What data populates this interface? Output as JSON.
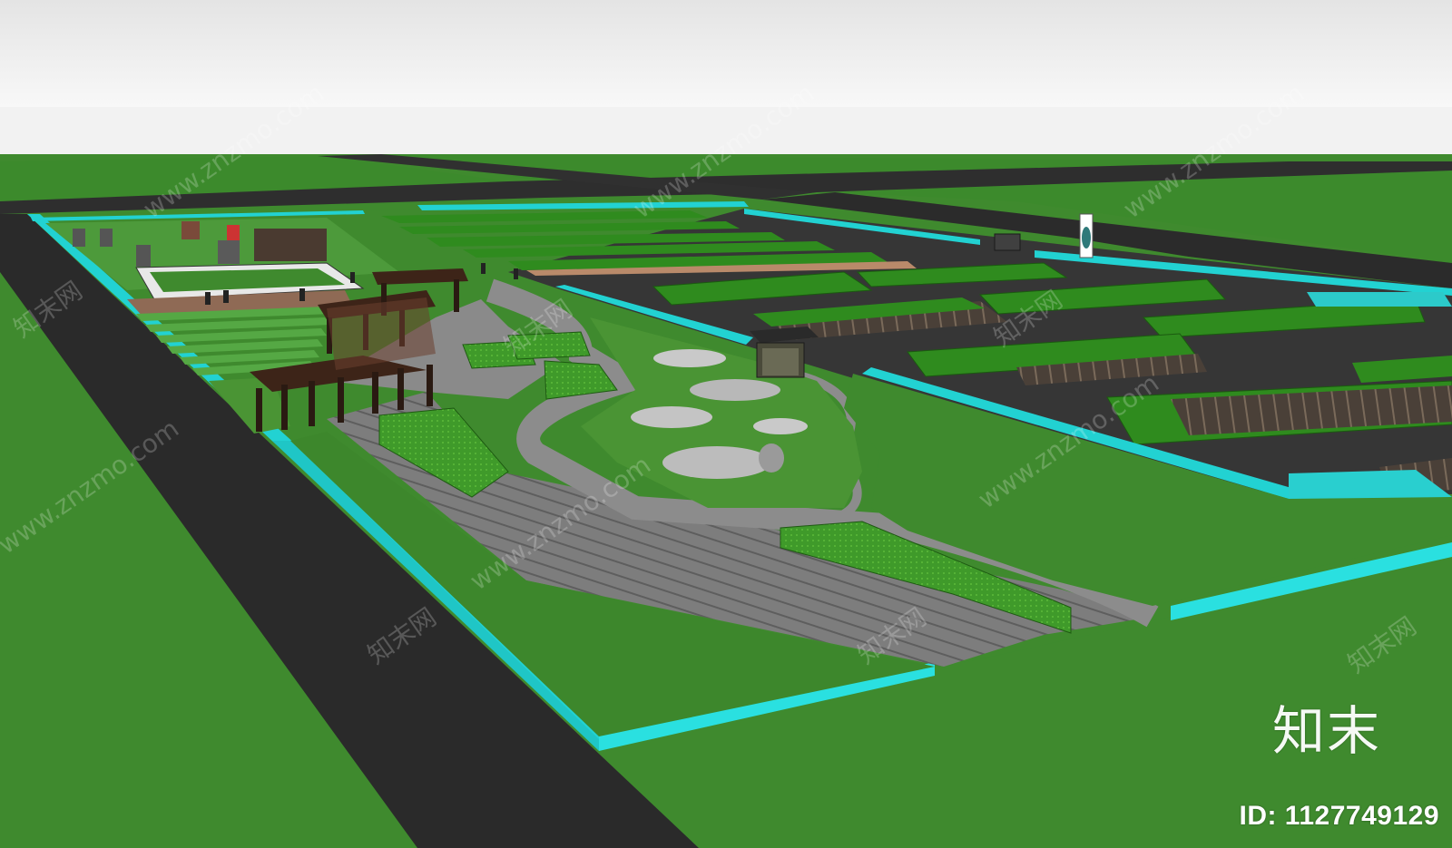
{
  "watermark": {
    "logo_text": "知末",
    "id_text": "ID: 1127749129",
    "tile_text": "www.znzmo.com",
    "tile_text_cn": "知末网"
  },
  "colors": {
    "sky_top": "#ececec",
    "sky_horizon": "#f7f7f7",
    "grass": "#3f8a2e",
    "grass_light": "#4f9a3a",
    "road": "#2d2d2d",
    "parking": "#3a3a3a",
    "curb": "#27d6d6",
    "plaza": "#7c7c7c",
    "path": "#8e8e8e",
    "pergola": "#3b2418",
    "hedge": "#2f7d1c",
    "hedge_bright": "#3fb21f"
  }
}
